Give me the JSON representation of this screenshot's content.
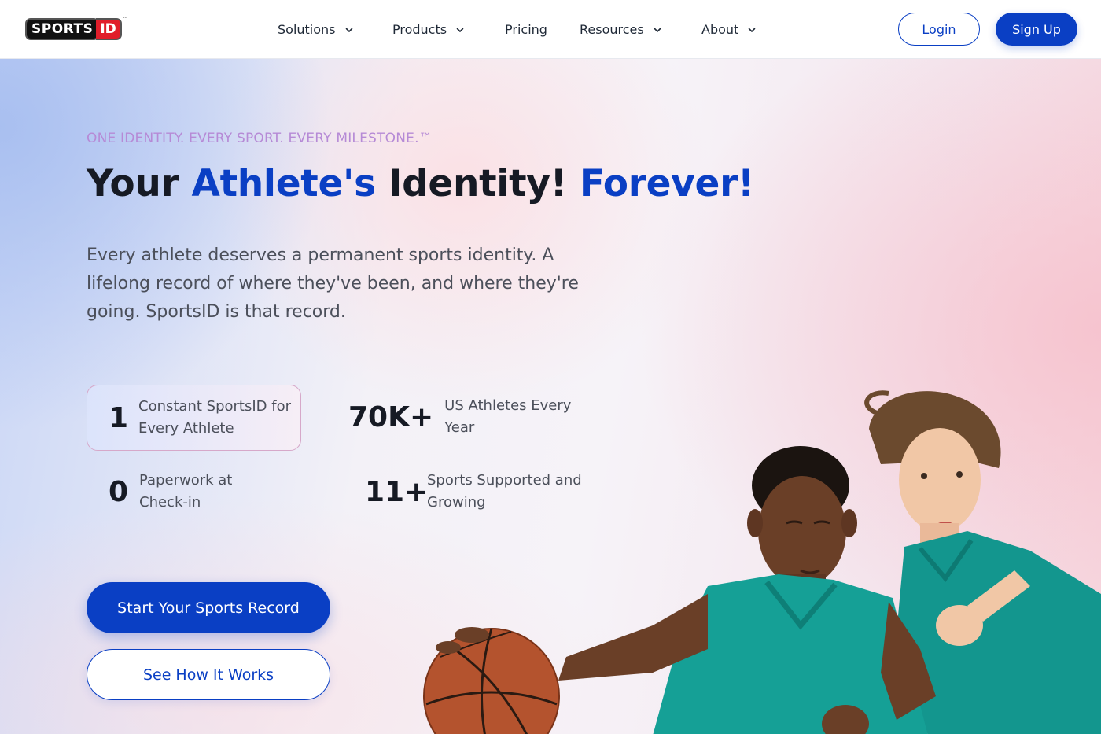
{
  "brand": {
    "logo_main": "SPORTS",
    "logo_id": "ID",
    "logo_tm": "™"
  },
  "nav": {
    "items": [
      {
        "label": "Solutions",
        "has_dropdown": true
      },
      {
        "label": "Products",
        "has_dropdown": true
      },
      {
        "label": "Pricing",
        "has_dropdown": false
      },
      {
        "label": "Resources",
        "has_dropdown": true
      },
      {
        "label": "About",
        "has_dropdown": true
      }
    ],
    "login_label": "Login",
    "signup_label": "Sign Up"
  },
  "hero": {
    "tagline": "ONE IDENTITY. EVERY SPORT. EVERY MILESTONE.™",
    "headline": {
      "part1": "Your ",
      "part2": "Athlete's",
      "part3": " Identity! ",
      "part4": "Forever!"
    },
    "description": "Every athlete deserves a permanent sports identity. A lifelong record of where they've been, and where they're going. SportsID is that record.",
    "stats": [
      {
        "value": "1",
        "label": "Constant SportsID for Every Athlete"
      },
      {
        "value": "70K+",
        "label": "US Athletes Every Year"
      },
      {
        "value": "0",
        "label": "Paperwork at Check-in"
      },
      {
        "value": "11+",
        "label": "Sports Supported and Growing"
      }
    ],
    "primary_cta": "Start Your Sports Record",
    "secondary_cta": "See How It Works"
  },
  "colors": {
    "accent": "#0a3fc4",
    "tagline": "#b68ad6",
    "heading": "#161a24",
    "body_text": "#4b4f5a",
    "logo_red": "#e11d2a",
    "jersey_teal": "#13968e"
  },
  "icons": {
    "nav_dropdown": "chevron-down-icon"
  }
}
